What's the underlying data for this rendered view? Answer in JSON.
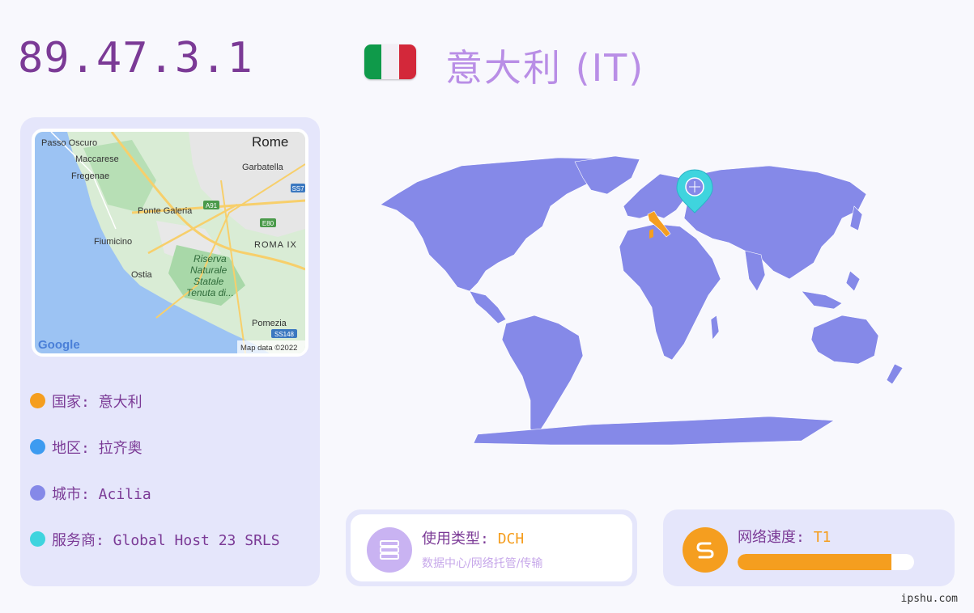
{
  "header": {
    "ip": "89.47.3.1",
    "country_title": "意大利 (IT)",
    "flag_colors": [
      "#0f9a4a",
      "#f3eef5",
      "#d3283a"
    ]
  },
  "mini_map": {
    "labels": {
      "passo_oscuro": "Passo Oscuro",
      "maccarese": "Maccarese",
      "fregenae": "Fregenae",
      "rome": "Rome",
      "garbatella": "Garbatella",
      "ponte_galeria": "Ponte Galeria",
      "fiumicino": "Fiumicino",
      "roma_ix": "ROMA IX",
      "ostia": "Ostia",
      "riserva_1": "Riserva",
      "riserva_2": "Naturale",
      "riserva_3": "Statale",
      "riserva_4": "Tenuta di...",
      "pomezia": "Pomezia",
      "google": "Google",
      "map_data": "Map data ©2022",
      "road_a91": "A91",
      "road_e80": "E80",
      "road_ss7": "SS7",
      "road_ss148": "SS148"
    }
  },
  "info": {
    "country": "国家: 意大利",
    "region": "地区: 拉齐奥",
    "city": "城市: Acilia",
    "isp": "服务商: Global Host 23 SRLS",
    "dot_colors": [
      "#f59e1f",
      "#3d9bf0",
      "#8589e8",
      "#3fd4de"
    ]
  },
  "usage": {
    "label": "使用类型: ",
    "value": "DCH",
    "sub": "数据中心/网络托管/传输",
    "icon": "server-icon"
  },
  "speed": {
    "label": "网络速度: ",
    "value": "T1",
    "level_percent": 87,
    "icon": "network-speed-icon"
  },
  "footer": {
    "site": "ipshu.com"
  },
  "colors": {
    "land": "#8589e8",
    "highlight": "#f59e1f",
    "pin": "#3fd4de",
    "usage_icon_bg": "#c9b3f2",
    "speed_icon_bg": "#f59e1f"
  }
}
